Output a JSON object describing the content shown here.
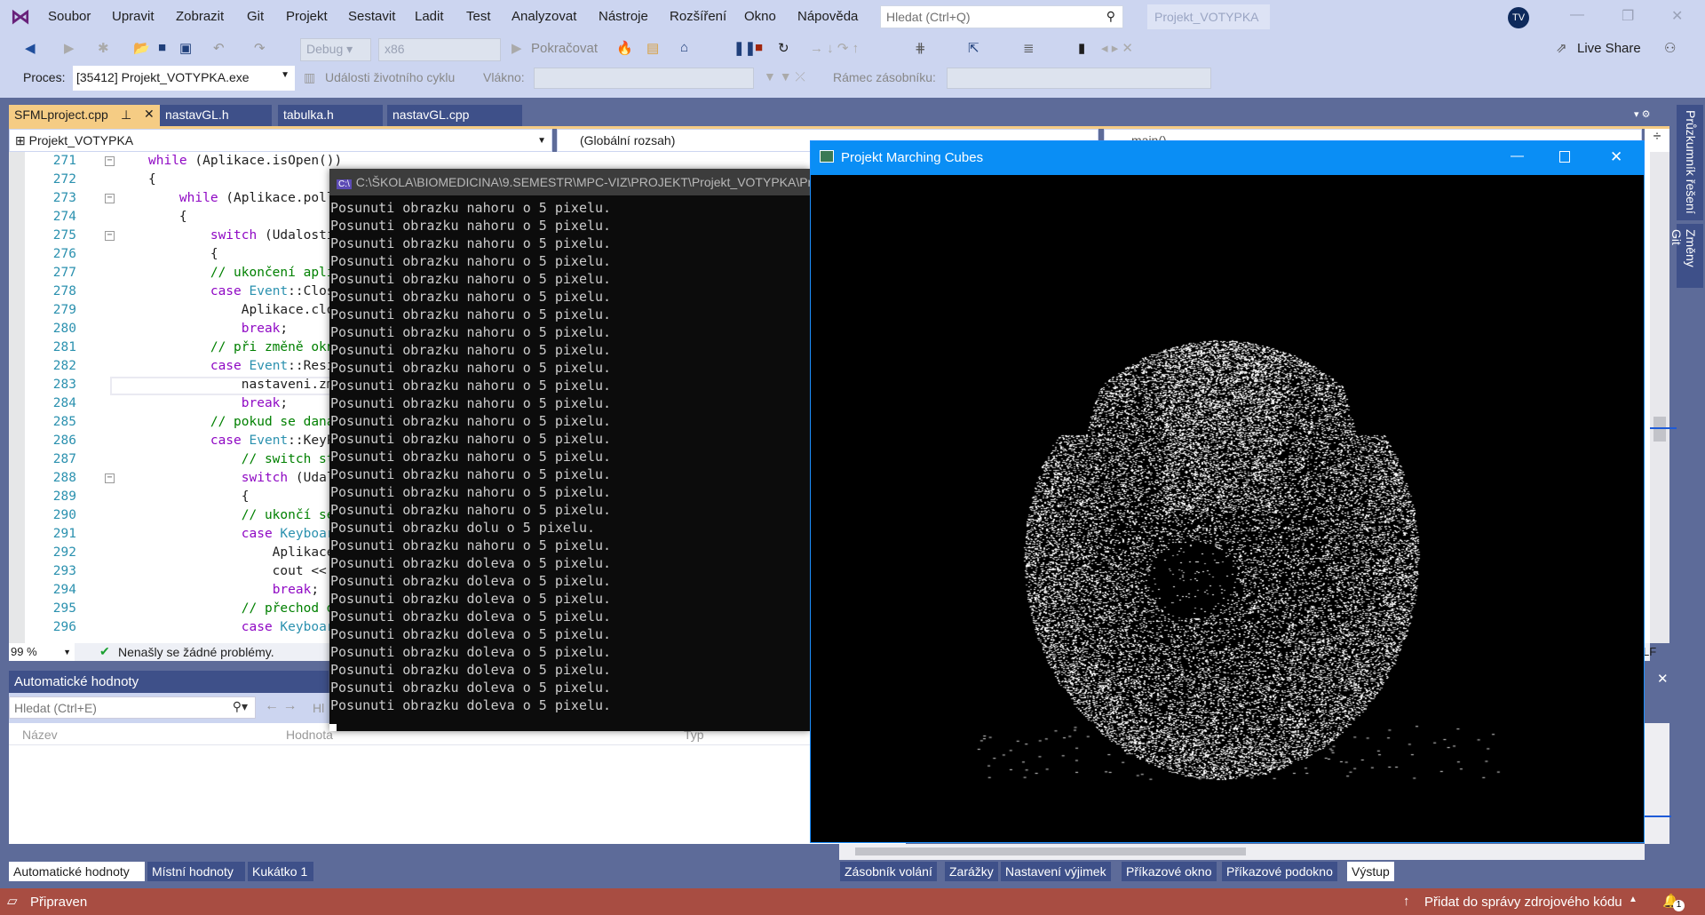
{
  "menu": [
    "Soubor",
    "Upravit",
    "Zobrazit",
    "Git",
    "Projekt",
    "Sestavit",
    "Ladit",
    "Test",
    "Analyzovat",
    "Nástroje",
    "Rozšíření",
    "Okno",
    "Nápověda"
  ],
  "search_placeholder": "Hledat (Ctrl+Q)",
  "solution_name": "Projekt_VOTYPKA",
  "user_initials": "TV",
  "toolbar": {
    "config": "Debug",
    "platform": "x86",
    "continue": "Pokračovat",
    "live_share": "Live Share"
  },
  "debugbar": {
    "process_label": "Proces:",
    "process_value": "[35412] Projekt_VOTYPKA.exe",
    "lifecycle": "Události životního cyklu",
    "thread_label": "Vlákno:",
    "stack_label": "Rámec zásobníku:"
  },
  "tabs": [
    "SFMLproject.cpp",
    "nastavGL.h",
    "tabulka.h",
    "nastavGL.cpp"
  ],
  "nav": {
    "project": "Projekt_VOTYPKA",
    "scope": "(Globální rozsah)",
    "member": "main()"
  },
  "code": [
    {
      "n": "271",
      "s": [
        [
          "k",
          "while"
        ],
        [
          "p",
          " (Aplikace.isOpen())"
        ]
      ],
      "f": true
    },
    {
      "n": "272",
      "s": [
        [
          "p",
          "{"
        ]
      ]
    },
    {
      "n": "273",
      "s": [
        [
          "p",
          "    "
        ],
        [
          "k",
          "while"
        ],
        [
          "p",
          " (Aplikace.poll"
        ]
      ],
      "f": true
    },
    {
      "n": "274",
      "s": [
        [
          "p",
          "    {"
        ]
      ]
    },
    {
      "n": "275",
      "s": [
        [
          "p",
          "        "
        ],
        [
          "k",
          "switch"
        ],
        [
          "p",
          " (Udalosti"
        ]
      ],
      "f": true
    },
    {
      "n": "276",
      "s": [
        [
          "p",
          "        {"
        ]
      ]
    },
    {
      "n": "277",
      "s": [
        [
          "c",
          "        // ukončení apli"
        ]
      ]
    },
    {
      "n": "278",
      "s": [
        [
          "p",
          "        "
        ],
        [
          "k",
          "case"
        ],
        [
          "p",
          " "
        ],
        [
          "t",
          "Event"
        ],
        [
          "p",
          "::Clos"
        ]
      ]
    },
    {
      "n": "279",
      "s": [
        [
          "p",
          "            Aplikace.clo"
        ]
      ]
    },
    {
      "n": "280",
      "s": [
        [
          "p",
          "            "
        ],
        [
          "k",
          "break"
        ],
        [
          "p",
          ";"
        ]
      ]
    },
    {
      "n": "281",
      "s": [
        [
          "c",
          "        // při změně okn"
        ]
      ]
    },
    {
      "n": "282",
      "s": [
        [
          "p",
          "        "
        ],
        [
          "k",
          "case"
        ],
        [
          "p",
          " "
        ],
        [
          "t",
          "Event"
        ],
        [
          "p",
          "::Resi"
        ]
      ]
    },
    {
      "n": "283",
      "s": [
        [
          "p",
          "            nastaveni.zm"
        ]
      ]
    },
    {
      "n": "284",
      "s": [
        [
          "p",
          "            "
        ],
        [
          "k",
          "break"
        ],
        [
          "p",
          ";"
        ]
      ]
    },
    {
      "n": "285",
      "s": [
        [
          "c",
          "        // pokud se daná"
        ]
      ]
    },
    {
      "n": "286",
      "s": [
        [
          "p",
          "        "
        ],
        [
          "k",
          "case"
        ],
        [
          "p",
          " "
        ],
        [
          "t",
          "Event"
        ],
        [
          "p",
          "::KeyP"
        ]
      ]
    },
    {
      "n": "287",
      "s": [
        [
          "c",
          "            // switch st"
        ]
      ]
    },
    {
      "n": "288",
      "s": [
        [
          "p",
          "            "
        ],
        [
          "k",
          "switch"
        ],
        [
          "p",
          " (Udal"
        ]
      ],
      "f": true
    },
    {
      "n": "289",
      "s": [
        [
          "p",
          "            {"
        ]
      ]
    },
    {
      "n": "290",
      "s": [
        [
          "c",
          "            // ukončí se"
        ]
      ]
    },
    {
      "n": "291",
      "s": [
        [
          "p",
          "            "
        ],
        [
          "k",
          "case"
        ],
        [
          "p",
          " "
        ],
        [
          "t",
          "Keyboar"
        ]
      ]
    },
    {
      "n": "292",
      "s": [
        [
          "p",
          "                Aplikace"
        ]
      ]
    },
    {
      "n": "293",
      "s": [
        [
          "p",
          "                cout <<"
        ]
      ]
    },
    {
      "n": "294",
      "s": [
        [
          "p",
          "                "
        ],
        [
          "k",
          "break"
        ],
        [
          "p",
          ";"
        ]
      ]
    },
    {
      "n": "295",
      "s": [
        [
          "c",
          "            // přechod d"
        ]
      ]
    },
    {
      "n": "296",
      "s": [
        [
          "p",
          "            "
        ],
        [
          "k",
          "case"
        ],
        [
          "p",
          " "
        ],
        [
          "t",
          "Keyboar"
        ]
      ]
    }
  ],
  "editor_status": {
    "zoom": "99 %",
    "issues": "Nenašly se žádné problémy.",
    "eol": "LF"
  },
  "console": {
    "title": "C:\\ŠKOLA\\BIOMEDICINA\\9.SEMESTR\\MPC-VIZ\\PROJEKT\\Projekt_VOTYPKA\\Pr",
    "lines": [
      "Posunuti obrazku nahoru o 5 pixelu.",
      "Posunuti obrazku nahoru o 5 pixelu.",
      "Posunuti obrazku nahoru o 5 pixelu.",
      "Posunuti obrazku nahoru o 5 pixelu.",
      "Posunuti obrazku nahoru o 5 pixelu.",
      "Posunuti obrazku nahoru o 5 pixelu.",
      "Posunuti obrazku nahoru o 5 pixelu.",
      "Posunuti obrazku nahoru o 5 pixelu.",
      "Posunuti obrazku nahoru o 5 pixelu.",
      "Posunuti obrazku nahoru o 5 pixelu.",
      "Posunuti obrazku nahoru o 5 pixelu.",
      "Posunuti obrazku nahoru o 5 pixelu.",
      "Posunuti obrazku nahoru o 5 pixelu.",
      "Posunuti obrazku nahoru o 5 pixelu.",
      "Posunuti obrazku nahoru o 5 pixelu.",
      "Posunuti obrazku nahoru o 5 pixelu.",
      "Posunuti obrazku nahoru o 5 pixelu.",
      "Posunuti obrazku nahoru o 5 pixelu.",
      "Posunuti obrazku dolu o 5 pixelu.",
      "Posunuti obrazku nahoru o 5 pixelu.",
      "Posunuti obrazku doleva o 5 pixelu.",
      "Posunuti obrazku doleva o 5 pixelu.",
      "Posunuti obrazku doleva o 5 pixelu.",
      "Posunuti obrazku doleva o 5 pixelu.",
      "Posunuti obrazku doleva o 5 pixelu.",
      "Posunuti obrazku doleva o 5 pixelu.",
      "Posunuti obrazku doleva o 5 pixelu.",
      "Posunuti obrazku doleva o 5 pixelu.",
      "Posunuti obrazku doleva o 5 pixelu."
    ]
  },
  "render_window": {
    "title": "Projekt Marching Cubes"
  },
  "autos": {
    "title": "Automatické hodnoty",
    "search_placeholder": "Hledat (Ctrl+E)",
    "depth_label": "Hl",
    "columns": [
      "Název",
      "Hodnota",
      "Typ"
    ]
  },
  "bottom_tabs_left": [
    "Automatické hodnoty",
    "Místní hodnoty",
    "Kukátko 1"
  ],
  "bottom_tabs_right": [
    "Zásobník volání",
    "Zarážky",
    "Nastavení výjimek",
    "Příkazové okno",
    "Příkazové podokno",
    "Výstup"
  ],
  "side_tabs": [
    "Průzkumník řešení",
    "Změny Git"
  ],
  "status": {
    "text": "Připraven",
    "source_control": "Přidat do správy zdrojového kódu",
    "notifications": "1"
  }
}
